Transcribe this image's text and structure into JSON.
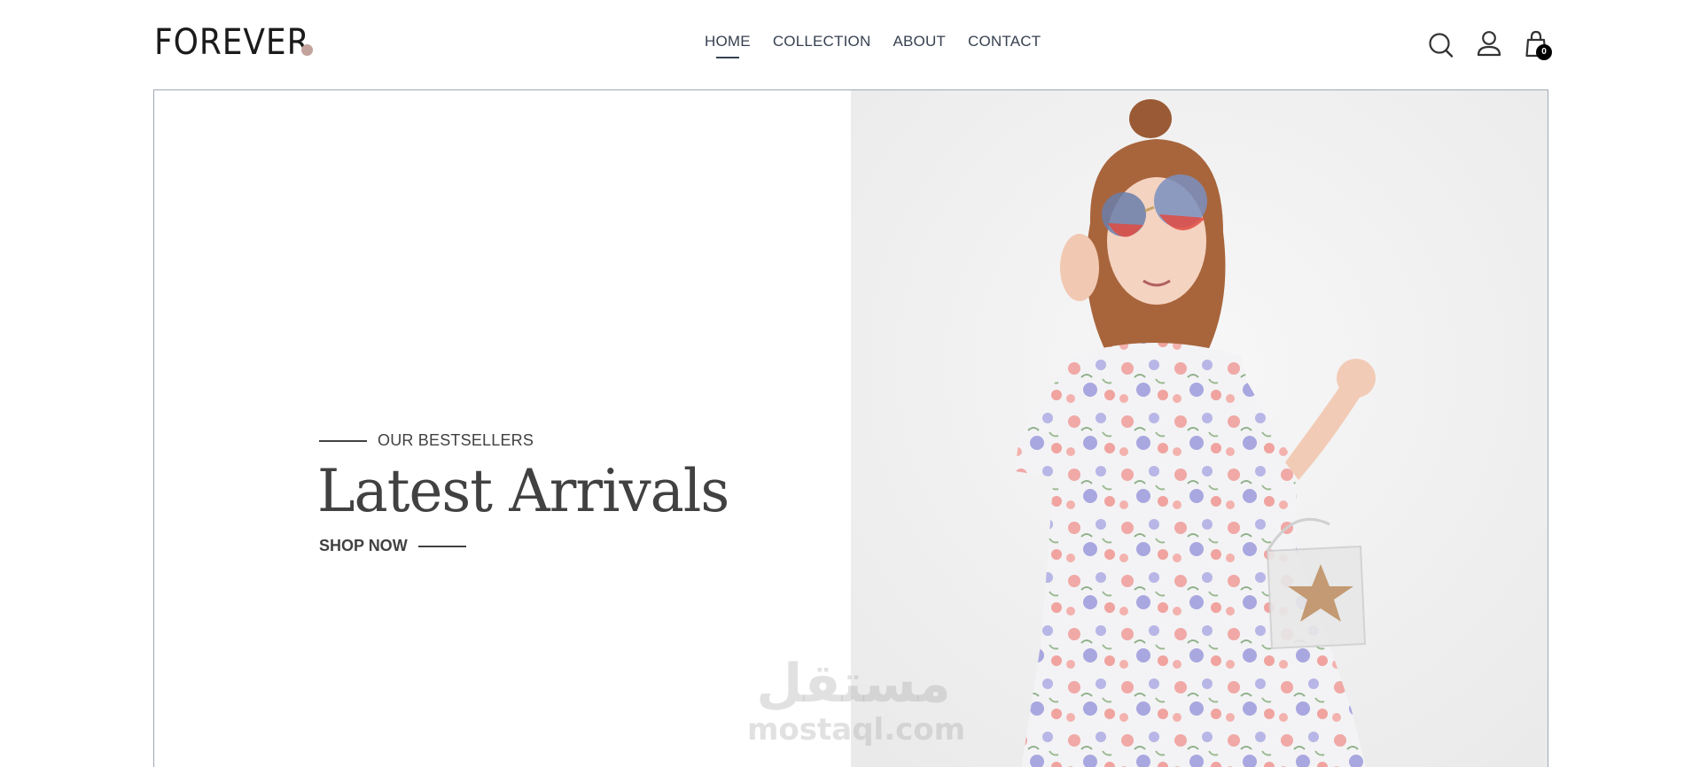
{
  "brand": {
    "logo_text": "FOREVER",
    "dot_color": "#c3a39c"
  },
  "nav": {
    "items": [
      {
        "label": "HOME",
        "active": true
      },
      {
        "label": "COLLECTION",
        "active": false
      },
      {
        "label": "ABOUT",
        "active": false
      },
      {
        "label": "CONTACT",
        "active": false
      }
    ]
  },
  "header_icons": {
    "search": "search-icon",
    "profile": "profile-icon",
    "cart": "cart-icon",
    "cart_count": "0"
  },
  "hero": {
    "eyebrow": "OUR BESTSELLERS",
    "title": "Latest Arrivals",
    "cta": "SHOP NOW",
    "image": "girl-in-floral-dress-with-sunglasses"
  },
  "watermark": {
    "arabic": "مستقل",
    "latin": "mostaql.com"
  },
  "colors": {
    "text": "#414141",
    "nav": "#374151",
    "hero_border": "#a1a7b3",
    "image_bg": "#efefef"
  }
}
